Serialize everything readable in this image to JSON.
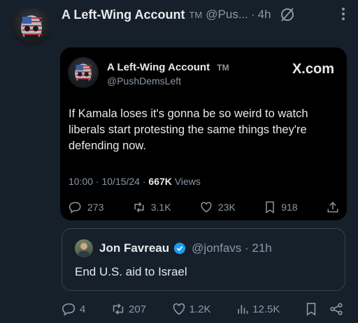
{
  "post": {
    "author_name": "A Left-Wing Account",
    "tm": "TM",
    "handle": "@Pus...",
    "sep": "·",
    "time": "4h"
  },
  "embed": {
    "author_name": "A Left-Wing Account",
    "tm": "TM",
    "handle": "@PushDemsLeft",
    "brand": "X.com",
    "text": "If Kamala loses it's gonna be so weird to watch liberals start protesting the same things they're defending now.",
    "meta_time": "10:00 · 10/15/24 · ",
    "views_count": "667K",
    "views_label": " Views",
    "replies": "273",
    "reposts": "3.1K",
    "likes": "23K",
    "bookmarks": "918"
  },
  "quote": {
    "author_name": "Jon Favreau",
    "handle": "@jonfavs · 21h",
    "text": "End U.S. aid to Israel"
  },
  "actions": {
    "replies": "4",
    "reposts": "207",
    "likes": "1.2K",
    "views": "12.5K"
  },
  "colors": {
    "background": "#15202b",
    "verified": "#1d9bf0",
    "muted": "#8b98a5"
  }
}
